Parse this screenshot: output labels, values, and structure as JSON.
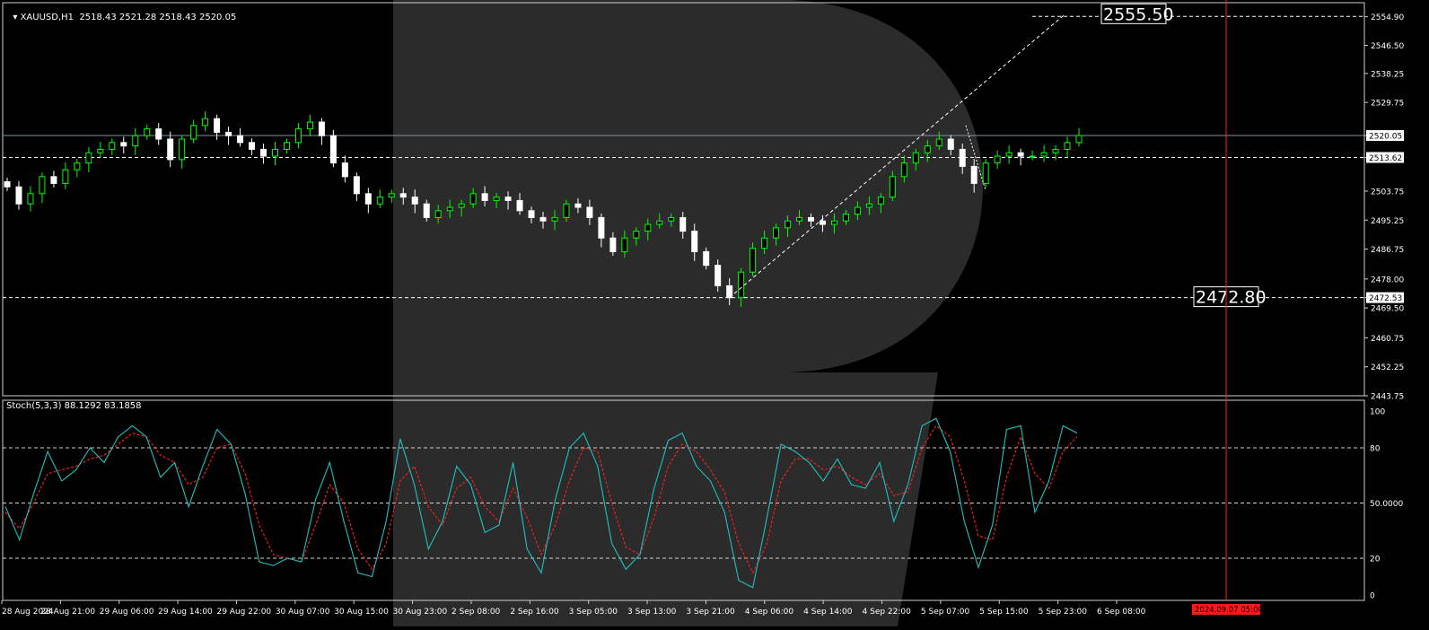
{
  "header": {
    "symbol": "XAUUSD,H1",
    "ohlc": "2518.43 2521.28 2518.43 2520.05"
  },
  "indicator": {
    "label": "Stoch(5,3,3) 88.1292 83.1858"
  },
  "colors": {
    "background": "#000000",
    "bull_candle": "#00ff00",
    "bear_candle": "#ffffff",
    "stoch_main": "#20c0c0",
    "stoch_signal": "#ff2020",
    "last_price_line": "#7f8fa6",
    "vline": "#ff2020",
    "watermark": "#2b2b2b"
  },
  "chart_data": [
    {
      "type": "candlestick",
      "symbol": "XAUUSD",
      "timeframe": "H1",
      "ylim": [
        2443.75,
        2559.0
      ],
      "y_ticks": [
        "2554.90",
        "2546.50",
        "2538.25",
        "2529.75",
        "2520.05",
        "2513.62",
        "2503.75",
        "2495.25",
        "2486.75",
        "2478.00",
        "2472.53",
        "2469.50",
        "2460.75",
        "2452.25",
        "2443.75"
      ],
      "x_ticks": [
        "28 Aug 2024",
        "28 Aug 21:00",
        "29 Aug 06:00",
        "29 Aug 14:00",
        "29 Aug 22:00",
        "30 Aug 07:00",
        "30 Aug 15:00",
        "30 Aug 23:00",
        "2 Sep 08:00",
        "2 Sep 16:00",
        "3 Sep 05:00",
        "3 Sep 13:00",
        "3 Sep 21:00",
        "4 Sep 06:00",
        "4 Sep 14:00",
        "4 Sep 22:00",
        "5 Sep 07:00",
        "5 Sep 15:00",
        "5 Sep 23:00",
        "6 Sep 08:00"
      ],
      "close_path": [
        2505,
        2500,
        2503,
        2508,
        2506,
        2510,
        2512,
        2515,
        2516,
        2518,
        2517,
        2520,
        2522,
        2519,
        2513,
        2519,
        2523,
        2525,
        2521,
        2520,
        2518,
        2516,
        2514,
        2516,
        2518,
        2522,
        2524,
        2520,
        2512,
        2508,
        2503,
        2500,
        2502,
        2503,
        2502,
        2500,
        2496,
        2498,
        2499,
        2500,
        2503,
        2501,
        2502,
        2501,
        2498,
        2496,
        2495,
        2496,
        2500,
        2499,
        2496,
        2490,
        2486,
        2490,
        2492,
        2494,
        2495,
        2496,
        2492,
        2486,
        2482,
        2476,
        2472.5,
        2480,
        2487,
        2490,
        2493,
        2495,
        2496,
        2495,
        2494,
        2495,
        2497,
        2499,
        2500,
        2502,
        2508,
        2512,
        2515,
        2517,
        2519,
        2516,
        2511,
        2506,
        2512,
        2514,
        2515,
        2514,
        2514,
        2515,
        2516,
        2518,
        2520.05
      ],
      "levels": {
        "last_price": 2520.05,
        "dashed_upper": 2513.62,
        "dashed_lower": 2472.53
      },
      "annotations": [
        {
          "text": "2555.50",
          "price": 2555.5
        },
        {
          "text": "2472.80",
          "price": 2472.53
        }
      ],
      "future_time_label": "2024.09.07 05:00"
    },
    {
      "type": "line",
      "name": "Stoch(5,3,3)",
      "ylim": [
        0,
        100
      ],
      "y_ticks": [
        "100",
        "80",
        "50.0000",
        "20",
        "0"
      ],
      "levels": [
        80,
        50,
        20
      ],
      "main": [
        48,
        30,
        55,
        78,
        62,
        68,
        80,
        72,
        86,
        92,
        86,
        64,
        72,
        48,
        70,
        90,
        82,
        55,
        18,
        16,
        20,
        18,
        52,
        72,
        40,
        12,
        10,
        40,
        85,
        60,
        25,
        40,
        70,
        60,
        34,
        38,
        72,
        25,
        12,
        52,
        80,
        88,
        70,
        28,
        14,
        22,
        58,
        84,
        88,
        70,
        62,
        45,
        8,
        4,
        42,
        82,
        78,
        72,
        62,
        74,
        60,
        58,
        72,
        40,
        60,
        92,
        96,
        78,
        40,
        15,
        38,
        90,
        92,
        45,
        62,
        92,
        88
      ],
      "signal": [
        45,
        36,
        50,
        66,
        68,
        70,
        74,
        76,
        82,
        88,
        86,
        76,
        72,
        60,
        64,
        80,
        82,
        66,
        38,
        22,
        20,
        18,
        38,
        60,
        50,
        25,
        14,
        28,
        62,
        70,
        48,
        38,
        58,
        64,
        48,
        40,
        58,
        42,
        22,
        38,
        62,
        80,
        78,
        50,
        26,
        22,
        42,
        70,
        82,
        78,
        68,
        56,
        28,
        12,
        28,
        62,
        74,
        74,
        68,
        70,
        64,
        60,
        66,
        54,
        56,
        80,
        92,
        86,
        62,
        32,
        30,
        64,
        86,
        66,
        58,
        78,
        86
      ]
    }
  ]
}
